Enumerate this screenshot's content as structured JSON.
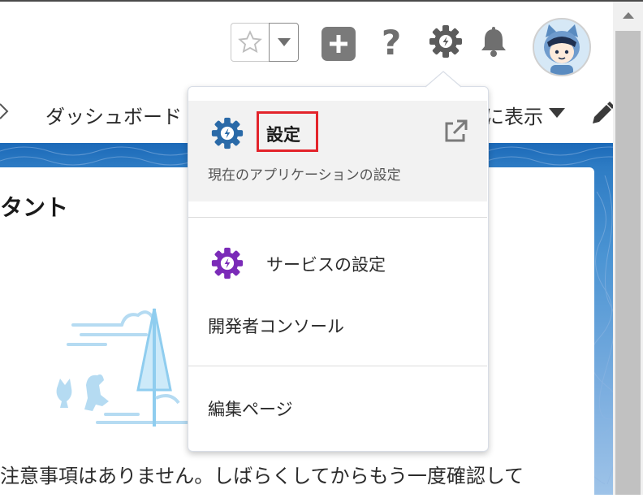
{
  "header": {
    "icons": [
      "star-icon",
      "chevron-down-icon",
      "plus-icon",
      "help-icon",
      "setup-gear-icon",
      "bell-icon",
      "avatar"
    ],
    "help_label": "?"
  },
  "nav": {
    "dashboard_label": "ダッシュボード",
    "view_label": "に表示"
  },
  "card": {
    "title": "タント",
    "empty_message": "注意事項はありません。しばらくしてからもう一度確認して"
  },
  "setup_menu": {
    "setup_label": "設定",
    "setup_subtitle": "現在のアプリケーションの設定",
    "service_setup_label": "サービスの設定",
    "developer_console_label": "開発者コンソール",
    "edit_page_label": "編集ページ"
  },
  "colors": {
    "setup_icon": "#2a6aa8",
    "service_icon": "#7b2bb8",
    "highlight": "#e3242b",
    "banner": "#1b69b8"
  }
}
